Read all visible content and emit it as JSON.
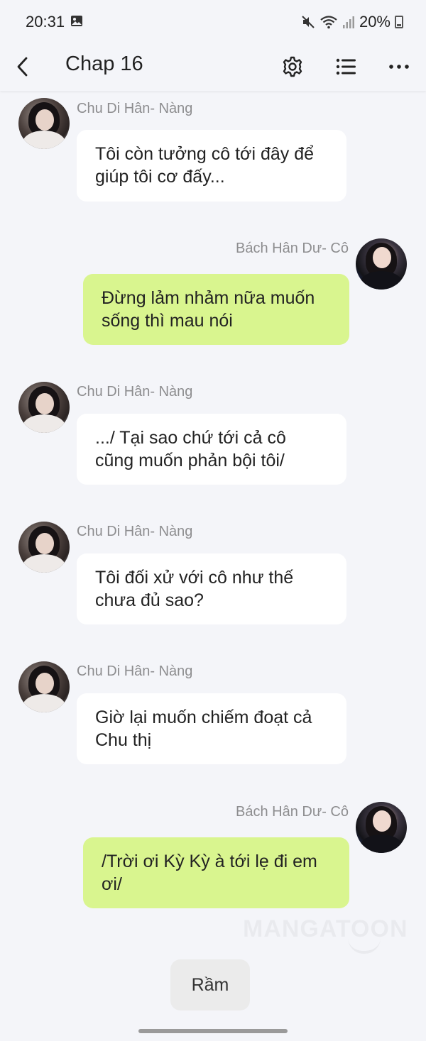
{
  "status": {
    "time": "20:31",
    "battery": "20%"
  },
  "toolbar": {
    "title": "Chap 16"
  },
  "messages": [
    {
      "side": "left",
      "author": "Chu Di Hân- Nàng",
      "text": "Tôi còn tưởng cô tới đây để giúp tôi cơ đấy..."
    },
    {
      "side": "right",
      "author": "Bách Hân Dư- Cô",
      "text": "Đừng lảm nhảm nữa muốn sống thì mau nói"
    },
    {
      "side": "left",
      "author": "Chu Di Hân- Nàng",
      "text": ".../ Tại sao chứ tới cả cô cũng muốn phản bội tôi/"
    },
    {
      "side": "left",
      "author": "Chu Di Hân- Nàng",
      "text": "Tôi đối xử với cô như thế chưa đủ sao?"
    },
    {
      "side": "left",
      "author": "Chu Di Hân- Nàng",
      "text": "Giờ lại muốn chiếm đoạt cả Chu thị"
    },
    {
      "side": "right",
      "author": "Bách Hân Dư- Cô",
      "text": "/Trời ơi Kỳ Kỳ à tới lẹ đi em ơi/"
    }
  ],
  "watermark": "MANGATOON",
  "sfx": "Rầm",
  "colors": {
    "background": "#f4f5f9",
    "left_bubble": "#ffffff",
    "right_bubble": "#d9f58f",
    "name_text": "#8d8d8f"
  }
}
